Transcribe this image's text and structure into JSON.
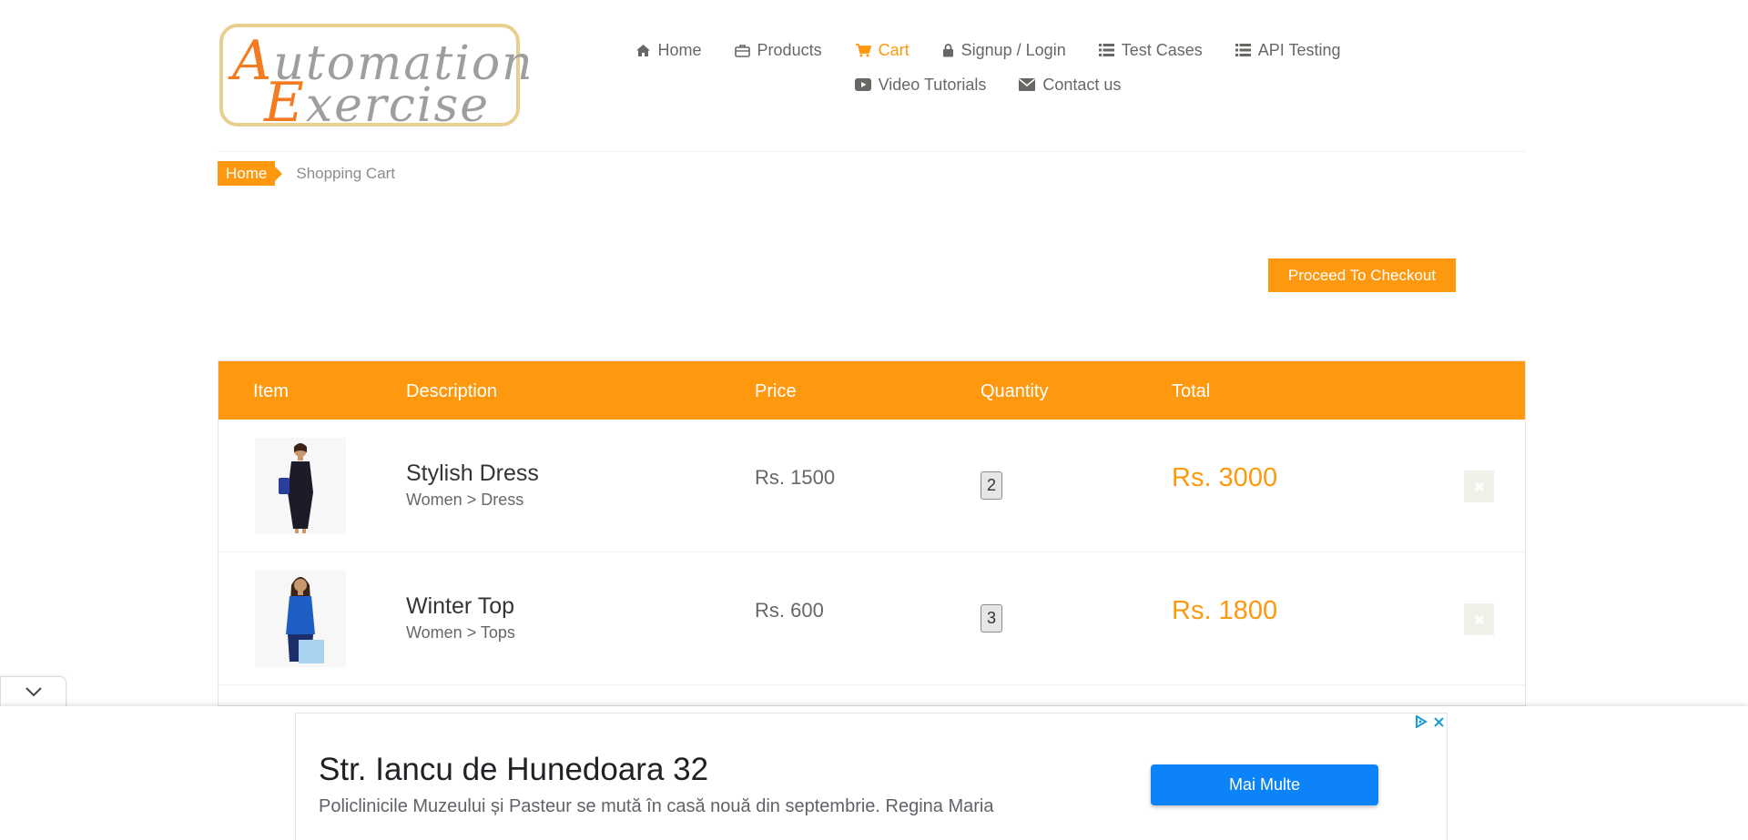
{
  "header": {
    "logo": {
      "line1_cap": "A",
      "line1_rest": "utomation",
      "line2_cap": "E",
      "line2_rest": "xercise"
    },
    "nav": [
      {
        "label": "Home",
        "icon": "home-icon"
      },
      {
        "label": "Products",
        "icon": "briefcase-icon"
      },
      {
        "label": "Cart",
        "icon": "cart-icon",
        "active": true
      },
      {
        "label": "Signup / Login",
        "icon": "lock-icon"
      },
      {
        "label": "Test Cases",
        "icon": "list-icon"
      },
      {
        "label": "API Testing",
        "icon": "list-icon"
      },
      {
        "label": "Video Tutorials",
        "icon": "youtube-icon"
      },
      {
        "label": "Contact us",
        "icon": "envelope-icon"
      }
    ]
  },
  "breadcrumb": {
    "home": "Home",
    "current": "Shopping Cart"
  },
  "checkout_label": "Proceed To Checkout",
  "table": {
    "headers": {
      "item": "Item",
      "description": "Description",
      "price": "Price",
      "quantity": "Quantity",
      "total": "Total"
    },
    "rows": [
      {
        "name": "Stylish Dress",
        "category": "Women > Dress",
        "price": "Rs. 1500",
        "quantity": "2",
        "total": "Rs. 3000",
        "dress_color": "#1b1b2a"
      },
      {
        "name": "Winter Top",
        "category": "Women > Tops",
        "price": "Rs. 600",
        "quantity": "3",
        "total": "Rs. 1800",
        "dress_color": "#1f5fc4"
      }
    ]
  },
  "ad": {
    "title": "Str. Iancu de Hunedoara 32",
    "description": "Policlinicile Muzeului și Pasteur se mută în casă nouă din septembrie. Regina Maria",
    "button": "Mai Multe"
  },
  "colors": {
    "accent": "#fe980f",
    "ad_button": "#0c83f8"
  }
}
